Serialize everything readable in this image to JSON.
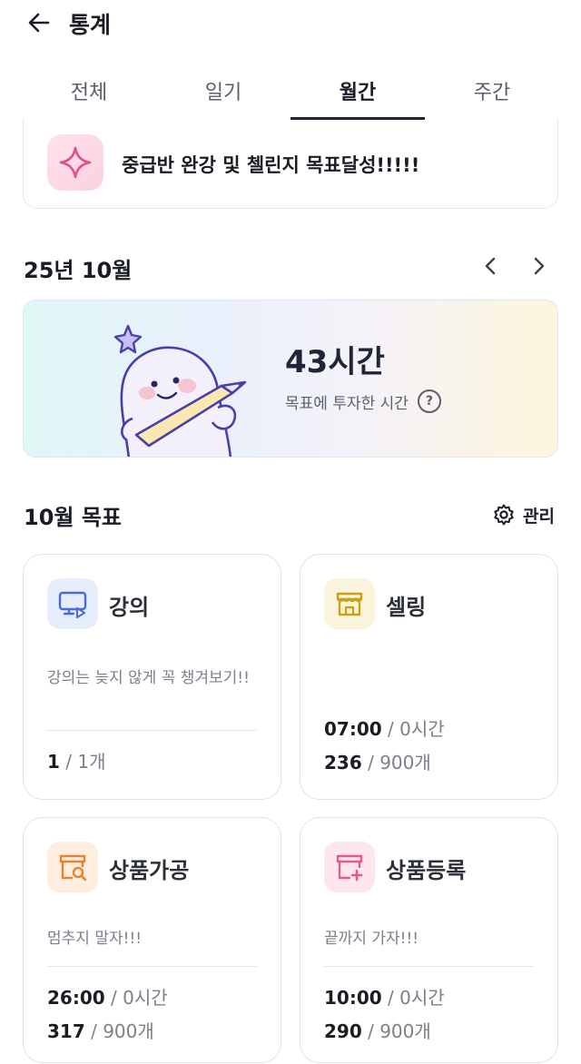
{
  "header": {
    "title": "통계"
  },
  "tabs": [
    {
      "label": "전체",
      "active": false
    },
    {
      "label": "일기",
      "active": false
    },
    {
      "label": "월간",
      "active": true
    },
    {
      "label": "주간",
      "active": false
    }
  ],
  "goal_banner": {
    "text": "중급반 완강 및 첼린지 목표달성!!!!!",
    "icon": "sparkle-icon"
  },
  "month": {
    "label": "25년 10월"
  },
  "hero": {
    "hours": "43시간",
    "subtitle": "목표에 투자한 시간",
    "help": "?"
  },
  "goals_section": {
    "title": "10월 목표",
    "manage_label": "관리"
  },
  "cards": [
    {
      "name": "강의",
      "icon": "monitor-play-icon",
      "icon_color": "#4d6ad8",
      "icon_bg": "#e6edfd",
      "desc": "강의는 늦지 않게 꼭 챙겨보기!!",
      "stat1_value": "1",
      "stat1_rest": " / 1개"
    },
    {
      "name": "셀링",
      "icon": "store-icon",
      "icon_color": "#caa111",
      "icon_bg": "#fbf4dc",
      "desc": "",
      "stat1_value": "07:00",
      "stat1_rest": " / 0시간",
      "stat2_value": "236",
      "stat2_rest": " / 900개"
    },
    {
      "name": "상품가공",
      "icon": "product-search-icon",
      "icon_color": "#e9822f",
      "icon_bg": "#fdeee0",
      "desc": "멈추지 말자!!!",
      "stat1_value": "26:00",
      "stat1_rest": " / 0시간",
      "stat2_value": "317",
      "stat2_rest": " / 900개"
    },
    {
      "name": "상품등록",
      "icon": "product-add-icon",
      "icon_color": "#e35a8b",
      "icon_bg": "#fde6ee",
      "desc": "끝까지 가자!!!",
      "stat1_value": "10:00",
      "stat1_rest": " / 0시간",
      "stat2_value": "290",
      "stat2_rest": " / 900개"
    }
  ]
}
